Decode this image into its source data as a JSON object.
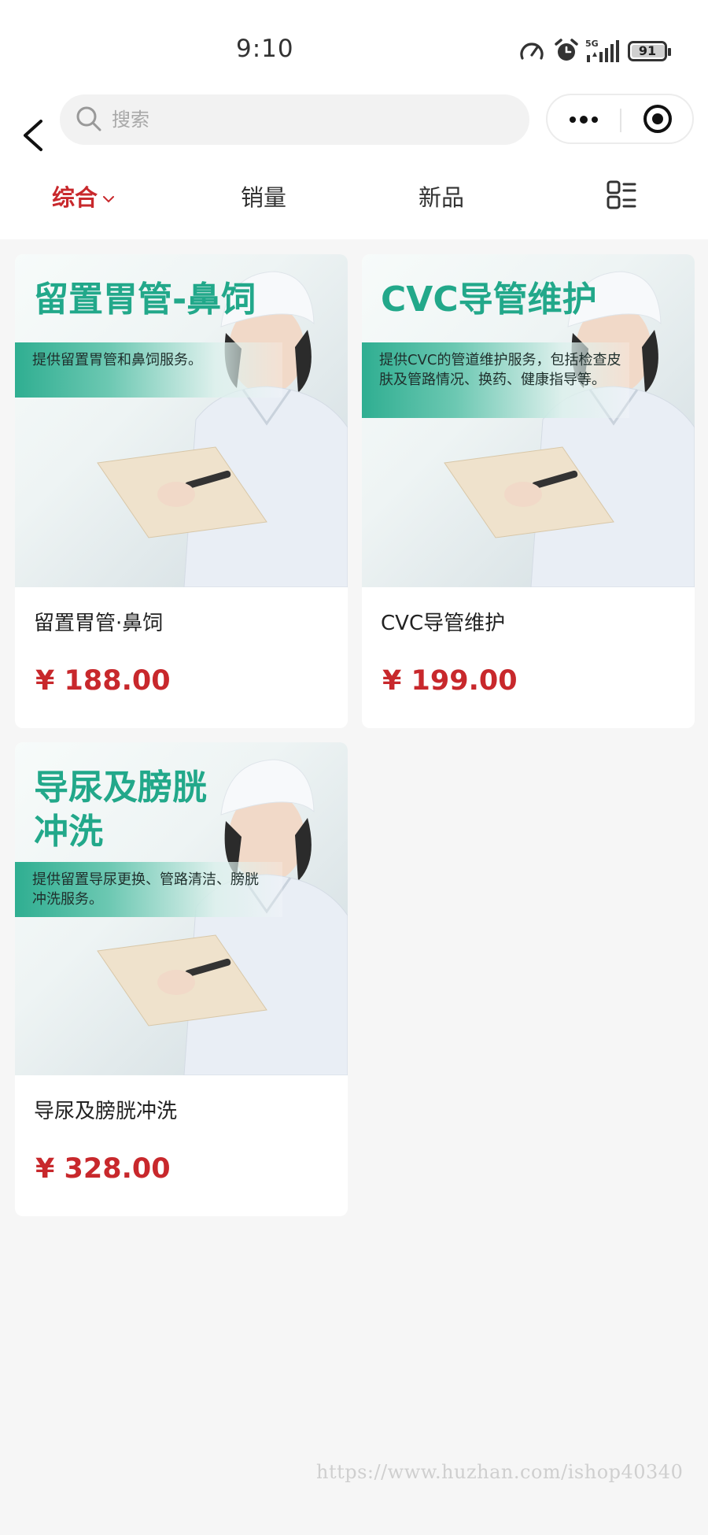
{
  "status_bar": {
    "time": "9:10",
    "network": "5G",
    "battery": "91",
    "icons": [
      "speed-icon",
      "alarm-icon",
      "signal-icon",
      "battery-icon"
    ]
  },
  "nav": {
    "back_icon": "back-chevron-icon",
    "search": {
      "placeholder": "搜索",
      "value": ""
    },
    "capsule": {
      "more_icon": "more-dots-icon",
      "close_icon": "target-icon"
    }
  },
  "sort_tabs": [
    {
      "label": "综合",
      "active": true,
      "has_dropdown": true
    },
    {
      "label": "销量",
      "active": false
    },
    {
      "label": "新品",
      "active": false
    }
  ],
  "layout_toggle_icon": "grid-list-icon",
  "colors": {
    "accent": "#c8282c",
    "banner_green": "#22a88a",
    "background": "#f6f6f6"
  },
  "products": [
    {
      "banner_title": "留置胃管-鼻饲",
      "banner_desc": "提供留置胃管和鼻饲服务。",
      "name": "留置胃管·鼻饲",
      "price": "¥ 188.00"
    },
    {
      "banner_title": "CVC导管维护",
      "banner_desc": "提供CVC的管道维护服务，包括检查皮肤及管路情况、换药、健康指导等。",
      "name": "CVC导管维护",
      "price": "¥ 199.00"
    },
    {
      "banner_title": "导尿及膀胱冲洗",
      "banner_desc": "提供留置导尿更换、管路清洁、膀胱冲洗服务。",
      "name": "导尿及膀胱冲洗",
      "price": "¥ 328.00"
    }
  ],
  "watermark": "https://www.huzhan.com/ishop40340"
}
